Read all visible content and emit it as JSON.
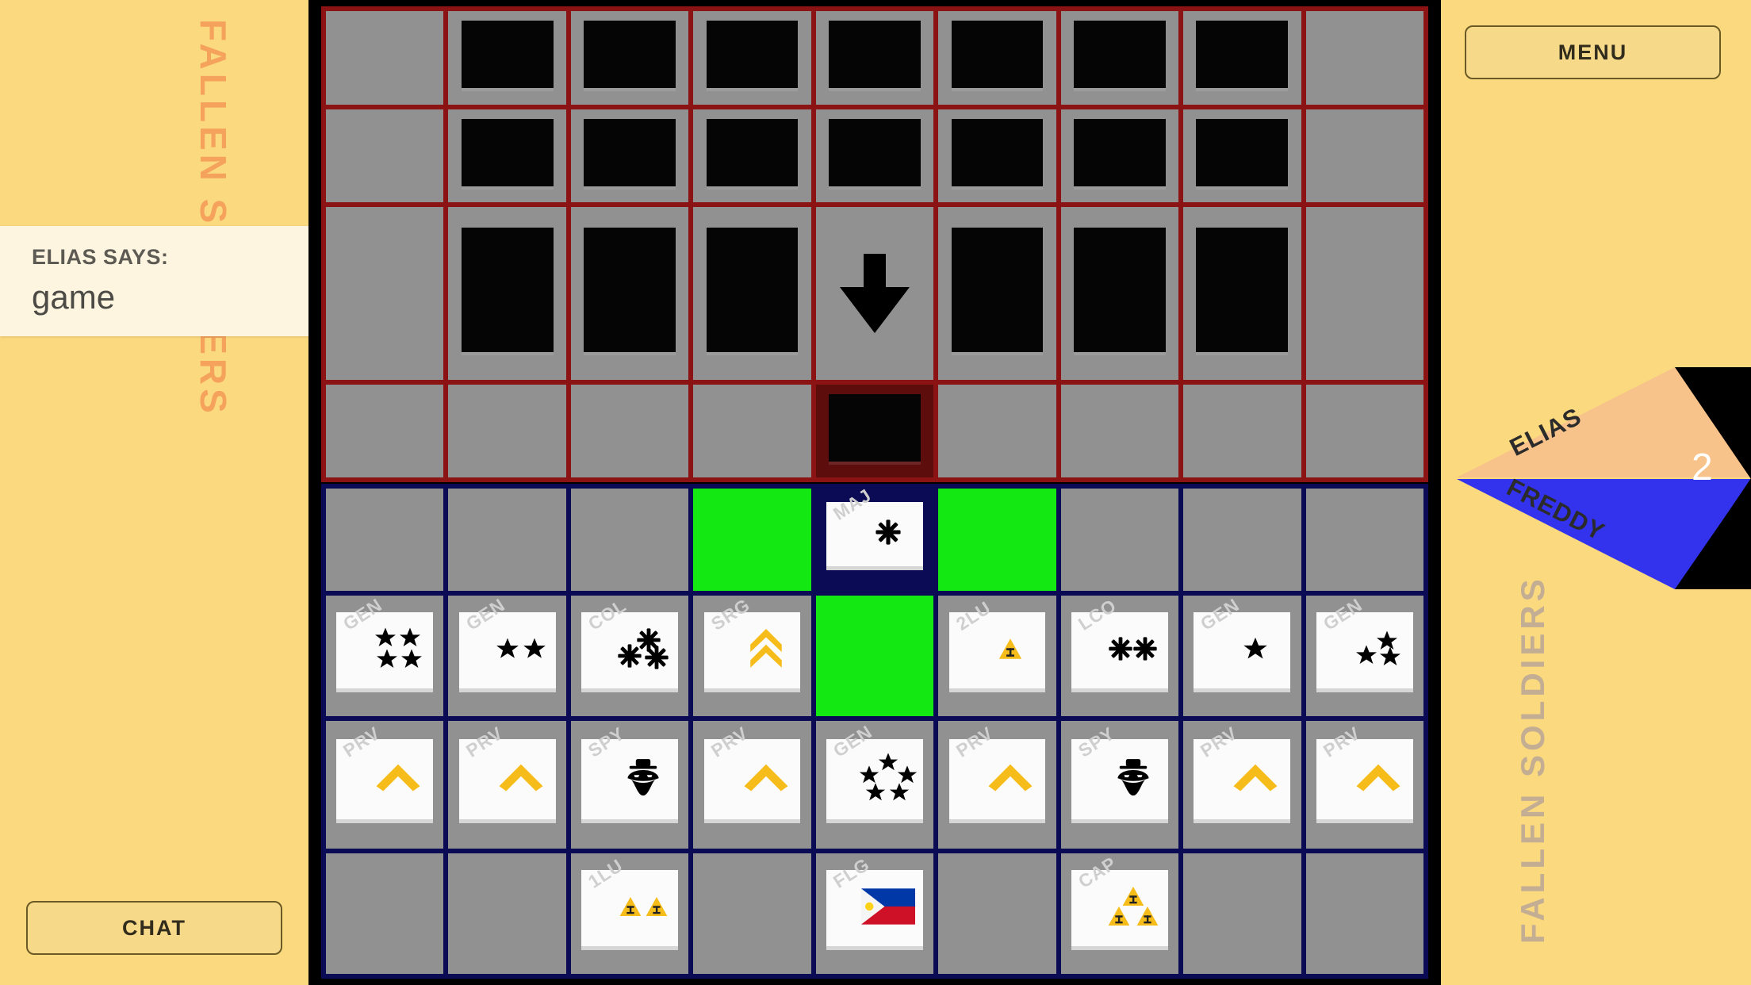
{
  "app": {
    "background_color": "#fbd97e",
    "fallen_soldiers_label_left": "FALLEN SOLDIERS",
    "fallen_soldiers_label_right": "FALLEN SOLDIERS"
  },
  "chat": {
    "sender_label": "ELIAS SAYS:",
    "message": "game",
    "chat_button_label": "CHAT"
  },
  "menu": {
    "menu_button_label": "MENU"
  },
  "turn": {
    "player_top": "ELIAS",
    "player_bottom": "FREDDY",
    "count": "2",
    "top_color": "#f8c38a",
    "bottom_color": "#3333ee",
    "badge_color": "#000000"
  },
  "board": {
    "columns": 9,
    "enemy_rows": 4,
    "player_rows": 4,
    "enemy_grid_color": "#8b1313",
    "player_grid_color": "#0b0b55",
    "cell_color": "#919191",
    "highlight_move_color": "#13e813",
    "enemy_cells": [
      [
        {
          "type": "empty"
        },
        {
          "type": "back"
        },
        {
          "type": "back"
        },
        {
          "type": "back"
        },
        {
          "type": "back"
        },
        {
          "type": "back"
        },
        {
          "type": "back"
        },
        {
          "type": "back"
        },
        {
          "type": "empty"
        }
      ],
      [
        {
          "type": "empty"
        },
        {
          "type": "back"
        },
        {
          "type": "back"
        },
        {
          "type": "back"
        },
        {
          "type": "back"
        },
        {
          "type": "back"
        },
        {
          "type": "back"
        },
        {
          "type": "back"
        },
        {
          "type": "empty"
        }
      ],
      [
        {
          "type": "empty"
        },
        {
          "type": "back"
        },
        {
          "type": "back"
        },
        {
          "type": "back"
        },
        {
          "type": "arrow",
          "direction": "down"
        },
        {
          "type": "back"
        },
        {
          "type": "back"
        },
        {
          "type": "back"
        },
        {
          "type": "empty"
        }
      ],
      [
        {
          "type": "empty"
        },
        {
          "type": "empty"
        },
        {
          "type": "empty"
        },
        {
          "type": "empty"
        },
        {
          "type": "back",
          "cell_highlight": "red"
        },
        {
          "type": "empty"
        },
        {
          "type": "empty"
        },
        {
          "type": "empty"
        },
        {
          "type": "empty"
        }
      ]
    ],
    "player_cells": [
      [
        {
          "type": "empty"
        },
        {
          "type": "empty"
        },
        {
          "type": "empty"
        },
        {
          "type": "empty",
          "cell_highlight": "green"
        },
        {
          "type": "piece",
          "rank": "MAJ",
          "insignia": "one-asterisk",
          "selected": true
        },
        {
          "type": "empty",
          "cell_highlight": "green"
        },
        {
          "type": "empty"
        },
        {
          "type": "empty"
        },
        {
          "type": "empty"
        }
      ],
      [
        {
          "type": "piece",
          "rank": "GEN",
          "insignia": "four-stars"
        },
        {
          "type": "piece",
          "rank": "GEN",
          "insignia": "two-stars"
        },
        {
          "type": "piece",
          "rank": "COL",
          "insignia": "three-asterisks"
        },
        {
          "type": "piece",
          "rank": "SRG",
          "insignia": "gold-double-chevron"
        },
        {
          "type": "empty",
          "cell_highlight": "green"
        },
        {
          "type": "piece",
          "rank": "2LU",
          "insignia": "one-gold-triangle"
        },
        {
          "type": "piece",
          "rank": "LCO",
          "insignia": "two-asterisks"
        },
        {
          "type": "piece",
          "rank": "GEN",
          "insignia": "one-star"
        },
        {
          "type": "piece",
          "rank": "GEN",
          "insignia": "three-stars"
        }
      ],
      [
        {
          "type": "piece",
          "rank": "PRV",
          "insignia": "gold-chevron"
        },
        {
          "type": "piece",
          "rank": "PRV",
          "insignia": "gold-chevron"
        },
        {
          "type": "piece",
          "rank": "SPY",
          "insignia": "spy-figure"
        },
        {
          "type": "piece",
          "rank": "PRV",
          "insignia": "gold-chevron"
        },
        {
          "type": "piece",
          "rank": "GEN",
          "insignia": "five-stars"
        },
        {
          "type": "piece",
          "rank": "PRV",
          "insignia": "gold-chevron"
        },
        {
          "type": "piece",
          "rank": "SPY",
          "insignia": "spy-figure"
        },
        {
          "type": "piece",
          "rank": "PRV",
          "insignia": "gold-chevron"
        },
        {
          "type": "piece",
          "rank": "PRV",
          "insignia": "gold-chevron"
        }
      ],
      [
        {
          "type": "empty"
        },
        {
          "type": "empty"
        },
        {
          "type": "piece",
          "rank": "1LU",
          "insignia": "two-gold-triangles"
        },
        {
          "type": "empty"
        },
        {
          "type": "piece",
          "rank": "FLG",
          "insignia": "philippine-flag"
        },
        {
          "type": "empty"
        },
        {
          "type": "piece",
          "rank": "CAP",
          "insignia": "three-gold-triangles"
        },
        {
          "type": "empty"
        },
        {
          "type": "empty"
        }
      ]
    ]
  }
}
